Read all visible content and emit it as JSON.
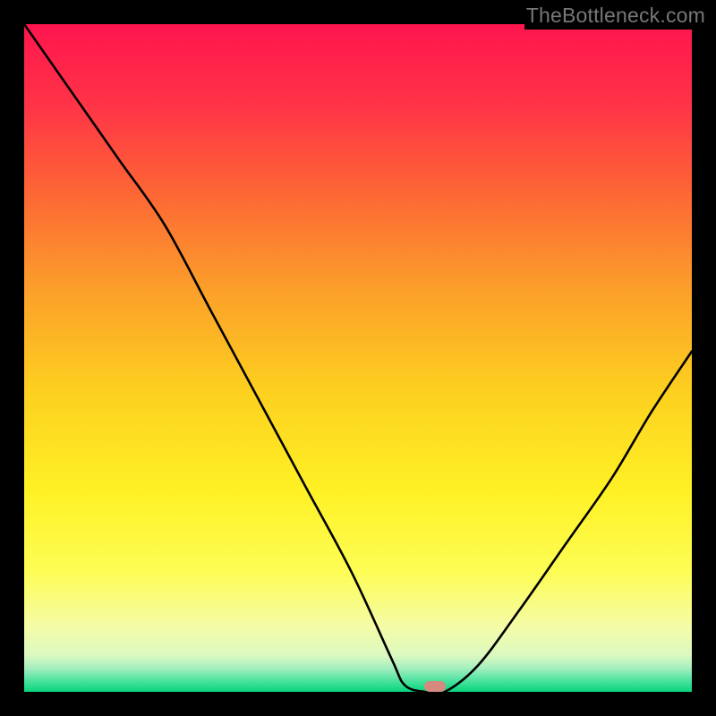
{
  "watermark": "TheBottleneck.com",
  "chart_data": {
    "type": "line",
    "title": "",
    "xlabel": "",
    "ylabel": "",
    "xlim": [
      0,
      100
    ],
    "ylim": [
      0,
      100
    ],
    "x": [
      0,
      7,
      14,
      21,
      28,
      35,
      42,
      49,
      55,
      57,
      60,
      63,
      68,
      74,
      81,
      88,
      94,
      100
    ],
    "values": [
      100,
      90,
      80,
      70,
      57,
      44,
      31,
      18,
      5,
      1,
      0,
      0,
      4,
      12,
      22,
      32,
      42,
      51
    ],
    "marker": {
      "x": 61.5,
      "y": 0.8,
      "color": "#d5897f"
    },
    "gradient_stops": [
      {
        "pos": 0.0,
        "color": "#ff154e"
      },
      {
        "pos": 0.12,
        "color": "#ff3347"
      },
      {
        "pos": 0.25,
        "color": "#fd6535"
      },
      {
        "pos": 0.4,
        "color": "#fca02a"
      },
      {
        "pos": 0.55,
        "color": "#fdd01f"
      },
      {
        "pos": 0.7,
        "color": "#fef125"
      },
      {
        "pos": 0.82,
        "color": "#fdfd55"
      },
      {
        "pos": 0.9,
        "color": "#f6fca5"
      },
      {
        "pos": 0.945,
        "color": "#dcf9c0"
      },
      {
        "pos": 0.965,
        "color": "#a3efbf"
      },
      {
        "pos": 0.983,
        "color": "#4ee29f"
      },
      {
        "pos": 1.0,
        "color": "#06d57d"
      }
    ],
    "curve_color": "#000000",
    "curve_width": 2.6
  }
}
